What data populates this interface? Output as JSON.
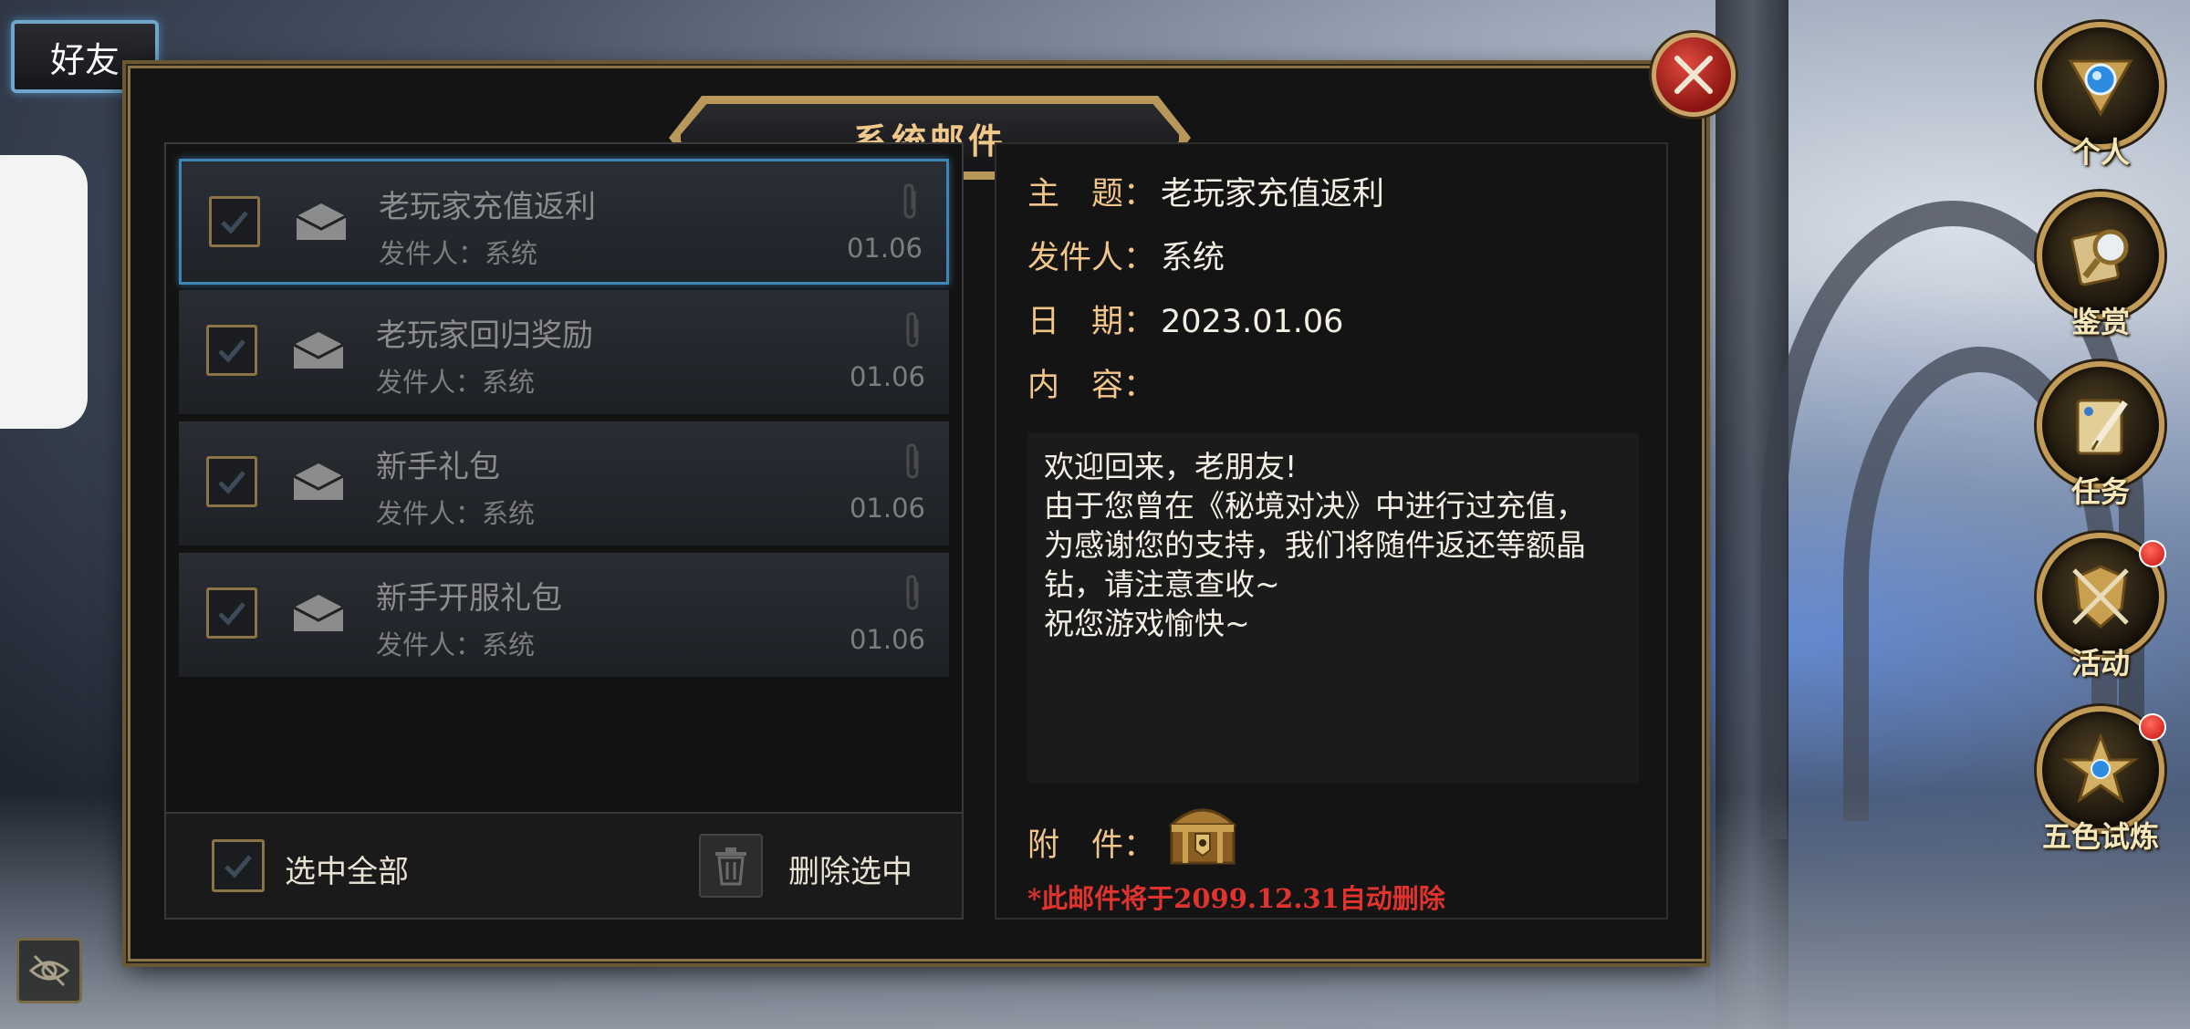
{
  "friend_tab": {
    "label": "好友"
  },
  "window": {
    "title": "系统邮件"
  },
  "mail_list": [
    {
      "title": "老玩家充值返利",
      "sender": "发件人：系统",
      "date": "01.06",
      "selected": true
    },
    {
      "title": "老玩家回归奖励",
      "sender": "发件人：系统",
      "date": "01.06",
      "selected": false
    },
    {
      "title": "新手礼包",
      "sender": "发件人：系统",
      "date": "01.06",
      "selected": false
    },
    {
      "title": "新手开服礼包",
      "sender": "发件人：系统",
      "date": "01.06",
      "selected": false
    }
  ],
  "footer": {
    "select_all_label": "选中全部",
    "delete_selected_label": "删除选中"
  },
  "detail": {
    "subject_label": "主　题：",
    "subject_value": "老玩家充值返利",
    "sender_label": "发件人：",
    "sender_value": "系统",
    "date_label": "日　期：",
    "date_value": "2023.01.06",
    "content_label": "内　容：",
    "content_lines": [
      "欢迎回来，老朋友!",
      "由于您曾在《秘境对决》中进行过充值，",
      "为感谢您的支持，我们将随件返还等额晶",
      "钻，请注意查收~",
      "祝您游戏愉快~"
    ],
    "attachment_label": "附　件：",
    "attachment_icon": "treasure-chest-icon",
    "auto_delete_notice": "*此邮件将于2099.12.31自动删除"
  },
  "side_menu": [
    {
      "label": "个人",
      "icon": "triangle-gem-icon",
      "has_badge": false
    },
    {
      "label": "鉴赏",
      "icon": "magnifier-scroll-icon",
      "has_badge": false
    },
    {
      "label": "任务",
      "icon": "quill-scroll-icon",
      "has_badge": false
    },
    {
      "label": "活动",
      "icon": "shield-swords-icon",
      "has_badge": true
    },
    {
      "label": "五色试炼",
      "icon": "star-gem-icon",
      "has_badge": true
    }
  ],
  "colors": {
    "accent_gold": "#f2c68a",
    "border_gold": "#8a7448",
    "selected_blue": "#3f86b8",
    "notice_red": "#e0332e"
  }
}
